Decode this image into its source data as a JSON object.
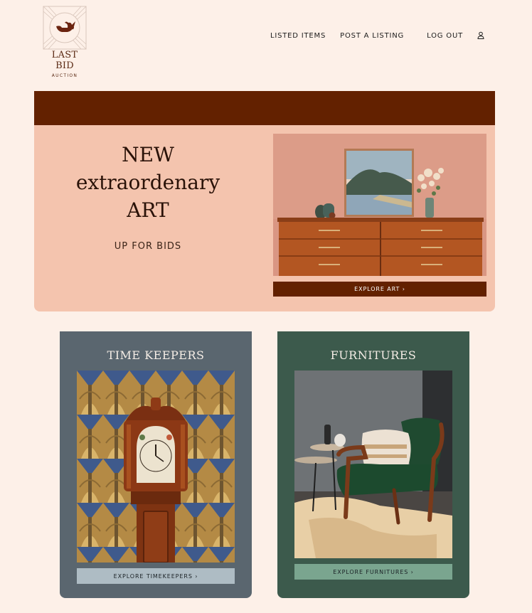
{
  "brand": {
    "name": "LAST BID",
    "tagline": "AUCTION"
  },
  "nav": {
    "listed_items": "LISTED ITEMS",
    "post_listing": "POST A LISTING",
    "log_out": "LOG OUT"
  },
  "hero": {
    "title_line1": "NEW",
    "title_line2": "extraordenary",
    "title_line3": "ART",
    "subtitle": "UP FOR BIDS",
    "button": "EXPLORE ART ›"
  },
  "cards": {
    "time": {
      "title": "TIME KEEPERS",
      "button": "EXPLORE TIMEKEEPERS ›"
    },
    "furniture": {
      "title": "FURNITURES",
      "button": "EXPLORE FURNITURES ›"
    }
  },
  "colors": {
    "background": "#fdf0e8",
    "brand_dark": "#632100",
    "hero_panel": "#f4c4ae",
    "card_slate": "#5a666f",
    "card_green": "#3c5a4c",
    "btn_slate": "#aebcc4",
    "btn_green": "#7aa58f"
  },
  "icons": {
    "logo": "teapot-logo-icon",
    "user": "user-icon"
  }
}
